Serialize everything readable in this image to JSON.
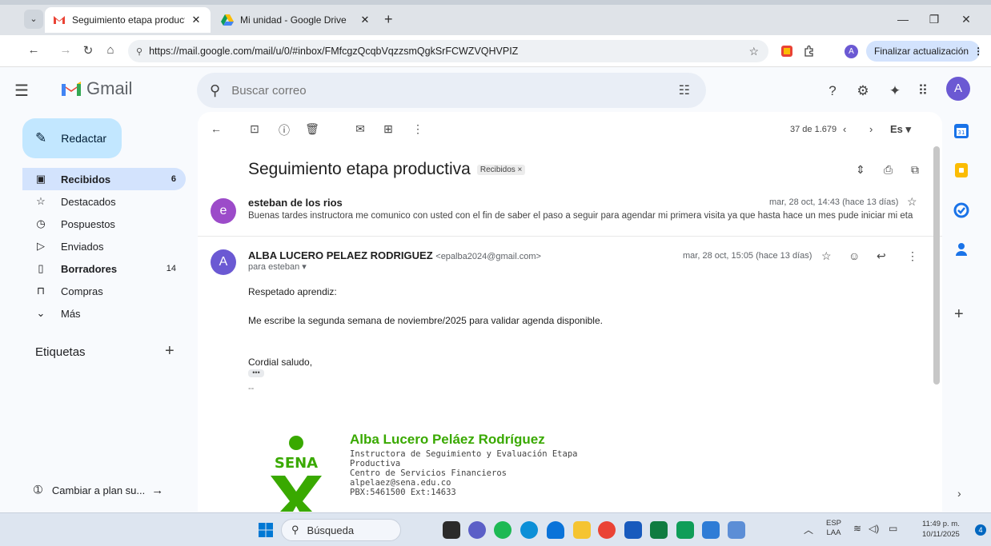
{
  "browser": {
    "tabs": [
      {
        "title": "Seguimiento etapa productiva -",
        "close": "✕"
      },
      {
        "title": "Mi unidad - Google Drive",
        "close": "✕"
      }
    ],
    "new_tab": "+",
    "url": "https://mail.google.com/mail/u/0/#inbox/FMfcgzQcqbVqzzsmQgkSrFCWZVQHVPIZ",
    "profile_initial": "A",
    "update_button": "Finalizar actualización"
  },
  "gmail": {
    "logo_text": "Gmail",
    "search_placeholder": "Buscar correo",
    "avatar_initial": "A",
    "compose_label": "Redactar",
    "nav": [
      {
        "label": "Recibidos",
        "count": "6"
      },
      {
        "label": "Destacados",
        "count": ""
      },
      {
        "label": "Pospuestos",
        "count": ""
      },
      {
        "label": "Enviados",
        "count": ""
      },
      {
        "label": "Borradores",
        "count": "14"
      },
      {
        "label": "Compras",
        "count": ""
      },
      {
        "label": "Más",
        "count": ""
      }
    ],
    "labels_title": "Etiquetas",
    "plan_label": "Cambiar a plan su..."
  },
  "thread": {
    "pager": "37 de 1.679",
    "lang": "Es",
    "subject": "Seguimiento etapa productiva",
    "label_chip": "Recibidos ×",
    "messages": [
      {
        "initial": "e",
        "sender": "esteban de los rios",
        "date": "mar, 28 oct, 14:43 (hace 13 días)",
        "snippet": "Buenas tardes instructora me comunico con usted con el fin de saber el paso a seguir para agendar mi primera visita ya que hasta hace un mes pude iniciar mi eta"
      },
      {
        "initial": "A",
        "sender": "ALBA LUCERO PELAEZ RODRIGUEZ",
        "email": "<epalba2024@gmail.com>",
        "date": "mar, 28 oct, 15:05 (hace 13 días)",
        "to": "para esteban",
        "body": [
          "Respetado aprendiz:",
          "Me escribe la segunda semana de noviembre/2025 para validar agenda disponible.",
          "Cordial saludo,"
        ],
        "ellipsis": "•••",
        "dashes": "--"
      }
    ],
    "signature": {
      "logo_text": "SENA",
      "name": "Alba Lucero Peláez Rodríguez",
      "lines": [
        "Instructora de Seguimiento y Evaluación Etapa",
        "Productiva",
        "Centro de Servicios Financieros",
        "alpelaez@sena.edu.co",
        "PBX:5461500 Ext:14633"
      ]
    }
  },
  "taskbar": {
    "search_label": "Búsqueda",
    "lang_line1": "ESP",
    "lang_line2": "LAA",
    "time": "11:49 p. m.",
    "date": "10/11/2025",
    "notif_count": "4"
  },
  "colors": {
    "compose_bg": "#c2e7ff",
    "selected_nav": "#d3e3fd",
    "avatar_e": "#9c4bc9",
    "avatar_a": "#6b59d3",
    "sena_green": "#39a900"
  }
}
